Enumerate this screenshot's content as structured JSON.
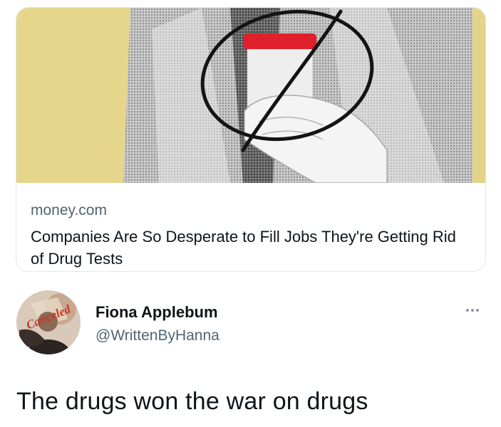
{
  "link_card": {
    "domain": "money.com",
    "title": "Companies Are So Desperate to Fill Jobs They're Getting Rid of Drug Tests",
    "image": "urine-sample-cup-crossed-out-photo"
  },
  "author": {
    "display_name": "Fiona Applebum",
    "handle": "@WrittenByHanna",
    "avatar_stamp": "Canceled"
  },
  "tweet": {
    "text": "The drugs won the war on drugs"
  },
  "icons": {
    "more": "more-dots-icon"
  },
  "colors": {
    "text_primary": "#0f1419",
    "text_secondary": "#536471",
    "cup_lid": "#e0202a",
    "image_background": "#e6d58a"
  }
}
